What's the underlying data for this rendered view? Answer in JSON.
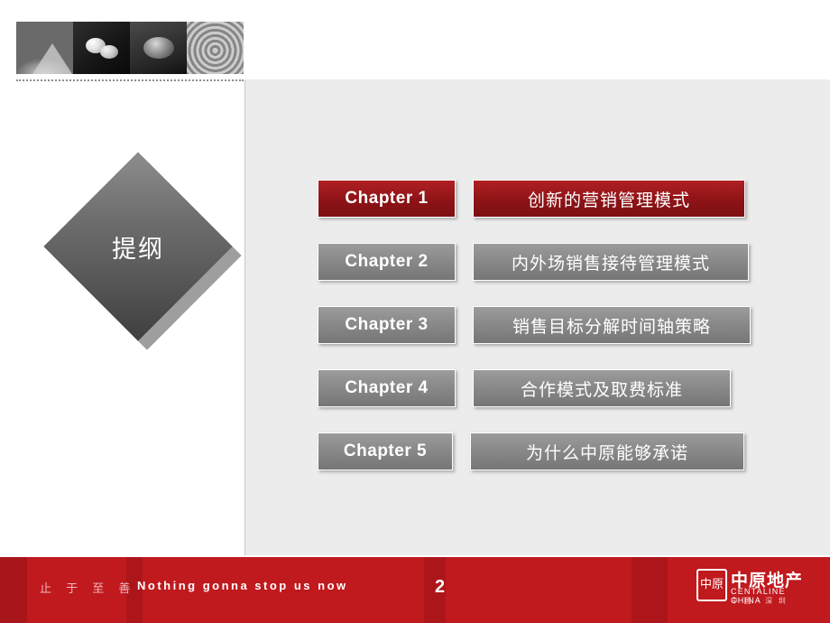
{
  "slide": {
    "diamond_label": "提纲",
    "page_number": "2"
  },
  "photo_strip": {
    "cells": [
      "zen-sand-cone-photo",
      "zen-stones-photo",
      "zen-pebble-photo",
      "zen-rings-photo"
    ]
  },
  "chapters": [
    {
      "number": "Chapter 1",
      "title": "创新的营销管理模式",
      "accent": "#8d1316"
    },
    {
      "number": "Chapter 2",
      "title": "内外场销售接待管理模式",
      "accent": "#868686"
    },
    {
      "number": "Chapter 3",
      "title": "销售目标分解时间轴策略",
      "accent": "#868686"
    },
    {
      "number": "Chapter 4",
      "title": "合作模式及取费标准",
      "accent": "#868686"
    },
    {
      "number": "Chapter 5",
      "title": "为什么中原能够承诺",
      "accent": "#868686"
    }
  ],
  "footer": {
    "slogan_cn": "止 于 至 善",
    "slogan_en": "Nothing  gonna  stop  us  now",
    "background": "#c0191e",
    "logo": {
      "mark": "中原",
      "name_cn": "中原地产",
      "name_en": "CENTALINE CHINA",
      "sub": "中 国 · 深 圳"
    }
  }
}
